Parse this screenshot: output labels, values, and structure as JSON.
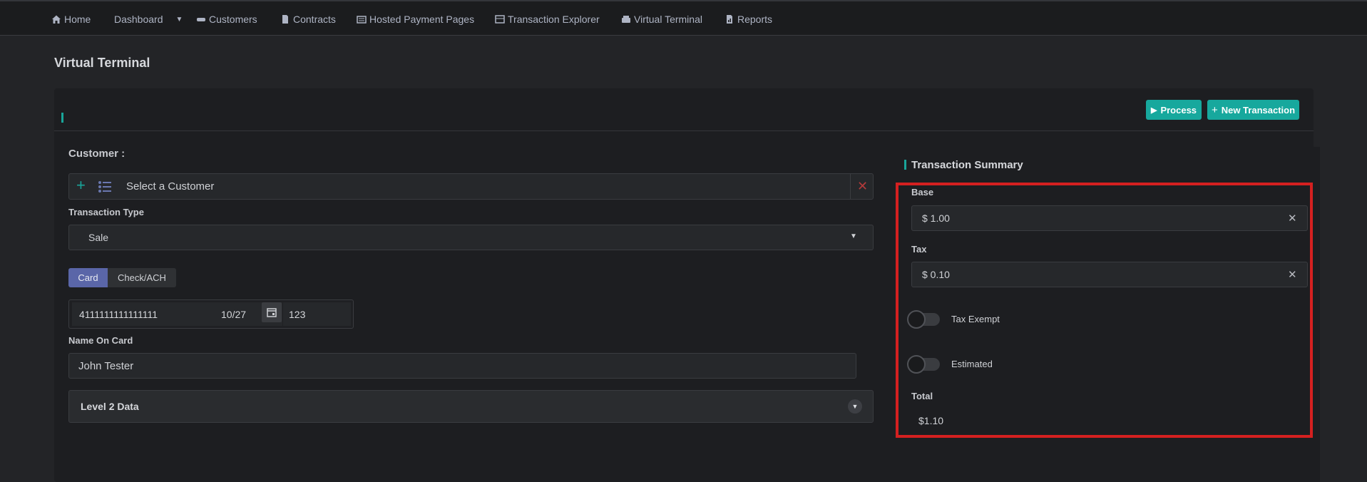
{
  "nav": {
    "home": "Home",
    "dashboard": "Dashboard",
    "customers": "Customers",
    "contracts": "Contracts",
    "hosted": "Hosted Payment Pages",
    "explorer": "Transaction Explorer",
    "terminal": "Virtual Terminal",
    "reports": "Reports"
  },
  "page": {
    "title": "Virtual Terminal"
  },
  "toolbar": {
    "process": "Process",
    "new_transaction": "New Transaction"
  },
  "customer": {
    "label": "Customer :",
    "placeholder": "Select a Customer"
  },
  "transaction_type": {
    "label": "Transaction Type",
    "value": "Sale"
  },
  "payment_tabs": {
    "card": "Card",
    "check": "Check/ACH",
    "active": "Card"
  },
  "card": {
    "number": "4111111111111111",
    "expiry": "10/27",
    "cvv": "123"
  },
  "name_on_card": {
    "label": "Name On Card",
    "value": "John Tester"
  },
  "level2": {
    "label": "Level 2 Data"
  },
  "summary": {
    "title": "Transaction Summary",
    "base_label": "Base",
    "base_value": "$ 1.00",
    "tax_label": "Tax",
    "tax_value": "$ 0.10",
    "tax_exempt_label": "Tax Exempt",
    "estimated_label": "Estimated",
    "total_label": "Total",
    "total_value": "$1.10"
  },
  "colors": {
    "accent": "#17a89d",
    "active_tab": "#5a66a8",
    "highlight": "#d42020",
    "clear": "#b33a3a"
  }
}
